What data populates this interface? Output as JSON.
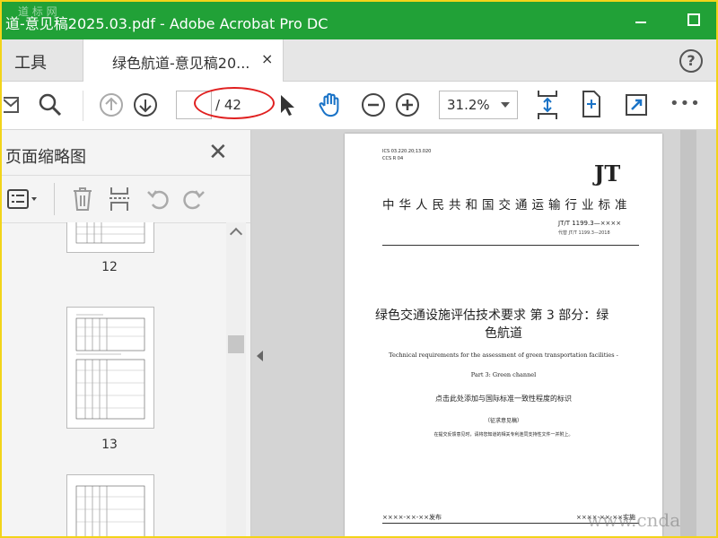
{
  "window": {
    "title": "道-意见稿2025.03.pdf - Adobe Acrobat Pro DC",
    "watermark_top": "道 标 网"
  },
  "tabs": {
    "tools_label": "工具",
    "doc_label": "绿色航道-意见稿20...",
    "close_glyph": "×",
    "help_glyph": "?"
  },
  "toolbar": {
    "page_value": "",
    "page_total": "/ 42",
    "zoom": "31.2%",
    "more_glyph": "•••"
  },
  "panel": {
    "title": "页面缩略图",
    "close_glyph": "✕",
    "thumbnails": [
      {
        "label": "12"
      },
      {
        "label": "13"
      },
      {
        "label": ""
      }
    ]
  },
  "document": {
    "ics": "ICS 03.220.20;13.020",
    "ccs": "CCS R 04",
    "jt_logo": "JT",
    "industry_standard": "中华人民共和国交通运输行业标准",
    "std_number": "JT/T 1199.3—××××",
    "replaces": "代替 JT/T 1199.3—2018",
    "title_cn_line1": "绿色交通设施评估技术要求  第 3 部分：绿",
    "title_cn_line2": "色航道",
    "title_en_line1": "Technical requirements for the assessment of green transportation facilities -",
    "title_en_line2": "Part 3: Green channel",
    "intl_note": "点击此处添加与国际标准一致性程度的标识",
    "draft_label": "（征求意见稿）",
    "submit_note": "在提交反馈意见时，请将您知道的相关专利连同支持性文件一并附上。",
    "publish": "××××-××-××发布",
    "implement": "××××-××-××实施"
  },
  "watermark_bottom": "www.cnda"
}
